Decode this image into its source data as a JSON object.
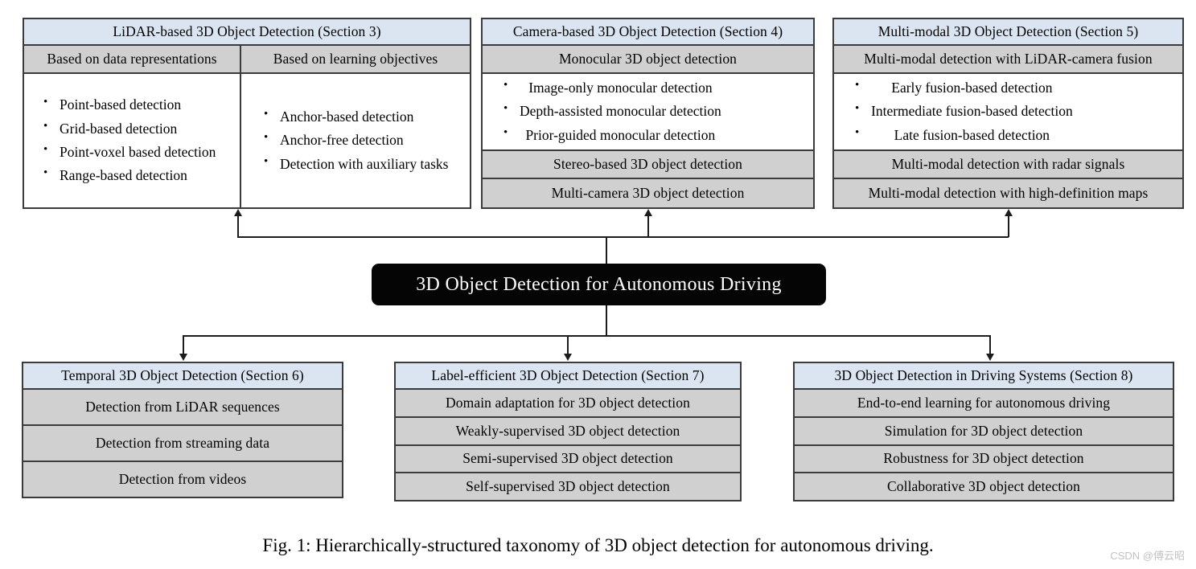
{
  "figure": {
    "caption": "Fig. 1: Hierarchically-structured taxonomy of 3D object detection for autonomous driving.",
    "watermark": "CSDN @傅云昭",
    "root_label": "3D Object Detection for Autonomous Driving",
    "colors": {
      "header_blue": "#dbe5f1",
      "row_gray": "#d0d0d0",
      "body_white": "#ffffff",
      "border": "#3b3b3b",
      "root_fill": "#050505",
      "root_text": "#ffffff"
    }
  },
  "top": {
    "lidar": {
      "header": "LiDAR-based 3D Object Detection (Section 3)",
      "subheader_left": "Based on data representations",
      "subheader_right": "Based on learning objectives",
      "bullets_left": [
        "Point-based detection",
        "Grid-based detection",
        "Point-voxel based detection",
        "Range-based detection"
      ],
      "bullets_right": [
        "Anchor-based detection",
        "Anchor-free detection",
        "Detection with auxiliary tasks"
      ]
    },
    "camera": {
      "header": "Camera-based 3D Object Detection (Section 4)",
      "subheader": "Monocular 3D object detection",
      "bullets": [
        "Image-only monocular detection",
        "Depth-assisted monocular detection",
        "Prior-guided monocular detection"
      ],
      "rows": [
        "Stereo-based 3D object detection",
        "Multi-camera 3D object detection"
      ]
    },
    "multimodal": {
      "header": "Multi-modal 3D Object Detection (Section 5)",
      "subheader": "Multi-modal detection with LiDAR-camera fusion",
      "bullets": [
        "Early fusion-based detection",
        "Intermediate fusion-based detection",
        "Late fusion-based detection"
      ],
      "rows": [
        "Multi-modal detection with radar signals",
        "Multi-modal detection with high-definition maps"
      ]
    }
  },
  "bottom": {
    "temporal": {
      "header": "Temporal 3D Object Detection (Section 6)",
      "rows": [
        "Detection from LiDAR sequences",
        "Detection from streaming data",
        "Detection from videos"
      ]
    },
    "label_efficient": {
      "header": "Label-efficient 3D Object Detection (Section 7)",
      "rows": [
        "Domain adaptation for 3D object detection",
        "Weakly-supervised 3D object detection",
        "Semi-supervised 3D object detection",
        "Self-supervised 3D object detection"
      ]
    },
    "driving_systems": {
      "header": "3D Object Detection in Driving Systems (Section 8)",
      "rows": [
        "End-to-end learning for autonomous driving",
        "Simulation for 3D object detection",
        "Robustness for 3D object detection",
        "Collaborative 3D object detection"
      ]
    }
  }
}
